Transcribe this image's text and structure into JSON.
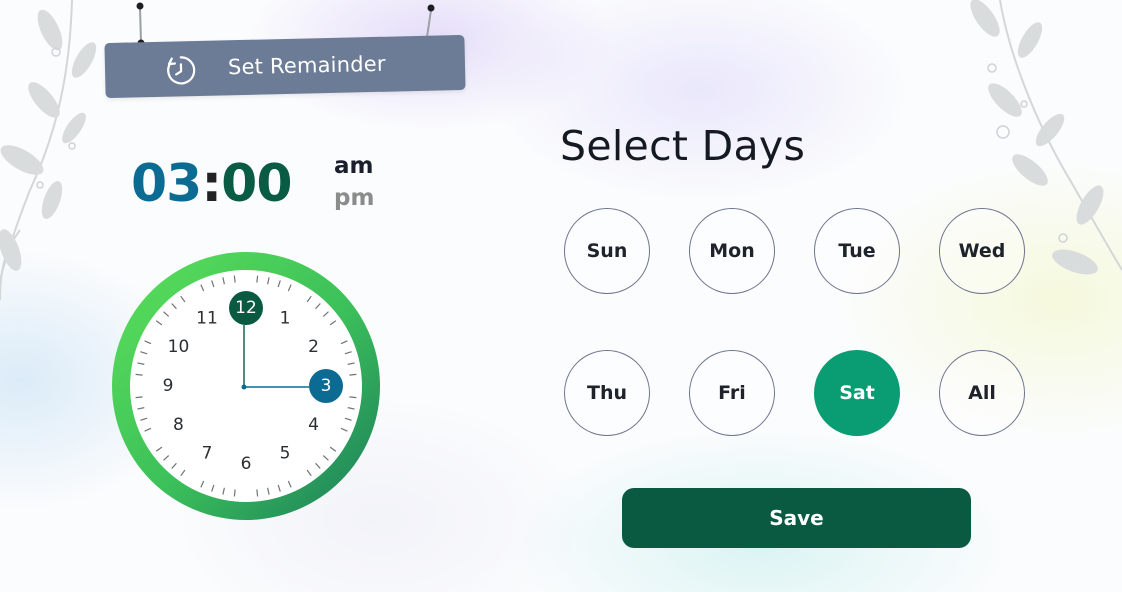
{
  "header": {
    "title": "Set Remainder",
    "icon": "clock-alarm-icon"
  },
  "time": {
    "hours": "03",
    "separator": ":",
    "minutes": "00",
    "am_label": "am",
    "pm_label": "pm",
    "selected_period": "am"
  },
  "clock": {
    "numbers": [
      "12",
      "1",
      "2",
      "3",
      "4",
      "5",
      "6",
      "7",
      "8",
      "9",
      "10",
      "11"
    ],
    "selected_hour": "12",
    "selected_minute_marker": "3",
    "hour_value": 12,
    "minute_value": 15
  },
  "days": {
    "title": "Select Days",
    "items": [
      {
        "label": "Sun",
        "selected": false
      },
      {
        "label": "Mon",
        "selected": false
      },
      {
        "label": "Tue",
        "selected": false
      },
      {
        "label": "Wed",
        "selected": false
      },
      {
        "label": "Thu",
        "selected": false
      },
      {
        "label": "Fri",
        "selected": false
      },
      {
        "label": "Sat",
        "selected": true
      },
      {
        "label": "All",
        "selected": false
      }
    ]
  },
  "actions": {
    "save_label": "Save"
  },
  "colors": {
    "primary_dark": "#0a5a42",
    "selected_day": "#0a9c73",
    "hour_text": "#0c6b93",
    "minute_marker": "#0c6b93",
    "sign_bg": "#6c7b96",
    "ring_start": "#5ce05a",
    "ring_end": "#1a7a5c"
  }
}
